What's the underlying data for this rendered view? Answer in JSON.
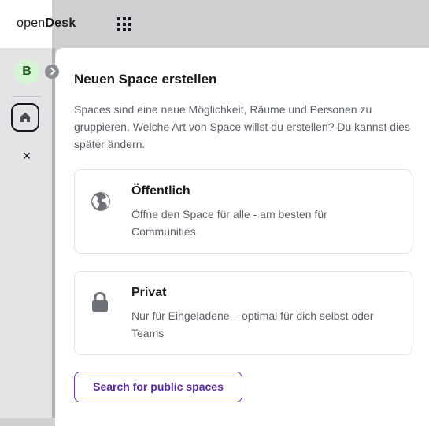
{
  "header": {
    "logo_light": "open",
    "logo_bold": "Desk",
    "launcher_icon": "app-grid-icon"
  },
  "sidebar": {
    "avatar_letter": "B",
    "avatar_bg": "#d6f5d4",
    "collapse_icon": "chevron-right-icon",
    "home_icon": "home-icon",
    "close_glyph": "×"
  },
  "dialog": {
    "title": "Neuen Space erstellen",
    "description": "Spaces sind eine neue Möglichkeit, Räume und Personen zu gruppieren. Welche Art von Space willst du erstellen? Du kannst dies später ändern.",
    "options": [
      {
        "icon": "globe-icon",
        "title": "Öffentlich",
        "description": "Öffne den Space für alle - am besten für Communities"
      },
      {
        "icon": "lock-icon",
        "title": "Privat",
        "description": "Nur für Eingeladene – optimal für dich selbst oder Teams"
      }
    ],
    "search_button": "Search for public spaces",
    "accent_color": "#5b2aa8"
  }
}
